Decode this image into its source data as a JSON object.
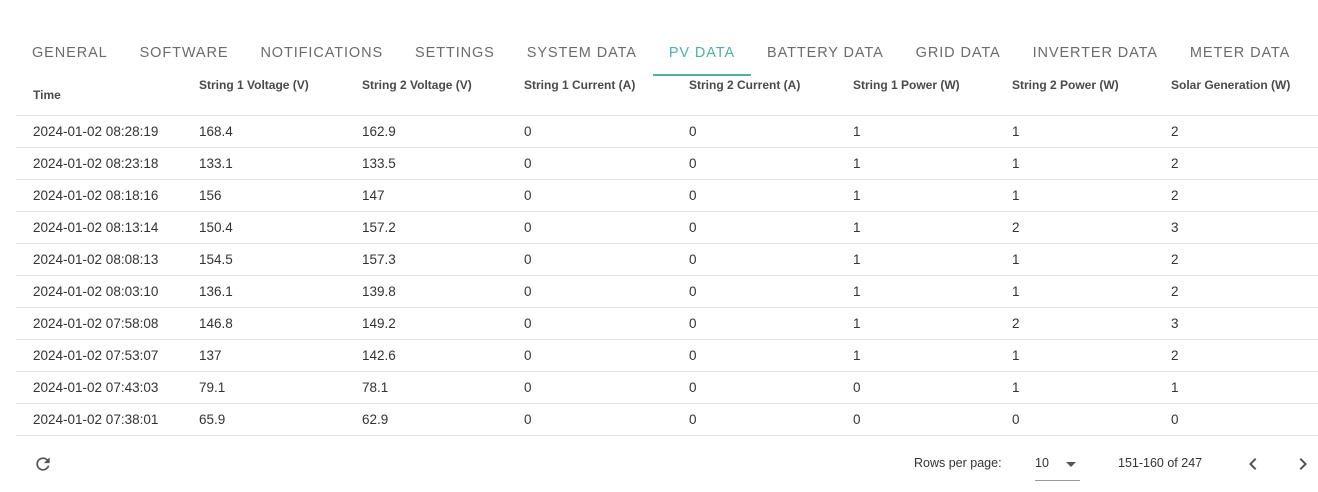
{
  "tabs": [
    {
      "label": "GENERAL",
      "active": false
    },
    {
      "label": "SOFTWARE",
      "active": false
    },
    {
      "label": "NOTIFICATIONS",
      "active": false
    },
    {
      "label": "SETTINGS",
      "active": false
    },
    {
      "label": "SYSTEM DATA",
      "active": false
    },
    {
      "label": "PV DATA",
      "active": true
    },
    {
      "label": "BATTERY DATA",
      "active": false
    },
    {
      "label": "GRID DATA",
      "active": false
    },
    {
      "label": "INVERTER DATA",
      "active": false
    },
    {
      "label": "METER DATA",
      "active": false
    }
  ],
  "table": {
    "columns": [
      "Time",
      "String 1 Voltage (V)",
      "String 2 Voltage (V)",
      "String 1 Current (A)",
      "String 2 Current (A)",
      "String 1 Power (W)",
      "String 2 Power (W)",
      "Solar Generation (W)"
    ],
    "rows": [
      [
        "2024-01-02 08:28:19",
        "168.4",
        "162.9",
        "0",
        "0",
        "1",
        "1",
        "2"
      ],
      [
        "2024-01-02 08:23:18",
        "133.1",
        "133.5",
        "0",
        "0",
        "1",
        "1",
        "2"
      ],
      [
        "2024-01-02 08:18:16",
        "156",
        "147",
        "0",
        "0",
        "1",
        "1",
        "2"
      ],
      [
        "2024-01-02 08:13:14",
        "150.4",
        "157.2",
        "0",
        "0",
        "1",
        "2",
        "3"
      ],
      [
        "2024-01-02 08:08:13",
        "154.5",
        "157.3",
        "0",
        "0",
        "1",
        "1",
        "2"
      ],
      [
        "2024-01-02 08:03:10",
        "136.1",
        "139.8",
        "0",
        "0",
        "1",
        "1",
        "2"
      ],
      [
        "2024-01-02 07:58:08",
        "146.8",
        "149.2",
        "0",
        "0",
        "1",
        "2",
        "3"
      ],
      [
        "2024-01-02 07:53:07",
        "137",
        "142.6",
        "0",
        "0",
        "1",
        "1",
        "2"
      ],
      [
        "2024-01-02 07:43:03",
        "79.1",
        "78.1",
        "0",
        "0",
        "0",
        "1",
        "1"
      ],
      [
        "2024-01-02 07:38:01",
        "65.9",
        "62.9",
        "0",
        "0",
        "0",
        "0",
        "0"
      ]
    ]
  },
  "footer": {
    "rows_per_page_label": "Rows per page:",
    "rows_per_page_value": "10",
    "range_text": "151-160 of 247"
  },
  "colors": {
    "accent": "#4fb1a2",
    "tab_text": "#6b6b6b",
    "divider": "#e3e3e3"
  },
  "icons": {
    "refresh": "refresh-icon",
    "dropdown": "chevron-down-icon",
    "prev": "chevron-left-icon",
    "next": "chevron-right-icon"
  }
}
